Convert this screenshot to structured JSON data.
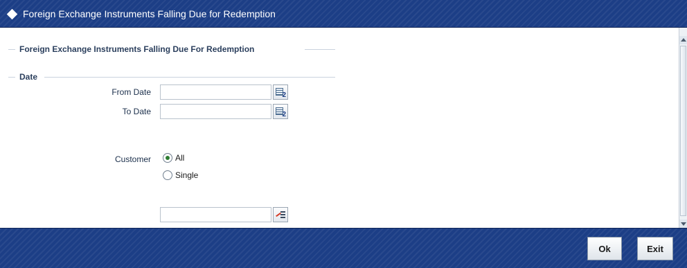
{
  "window": {
    "title": "Foreign Exchange Instruments Falling Due for Redemption"
  },
  "main_section": {
    "legend": "Foreign Exchange Instruments Falling Due For Redemption"
  },
  "date_section": {
    "legend": "Date",
    "from_date_label": "From Date",
    "from_date_value": "",
    "to_date_label": "To Date",
    "to_date_value": ""
  },
  "customer": {
    "label": "Customer",
    "options": [
      {
        "label": "All",
        "selected": true
      },
      {
        "label": "Single",
        "selected": false
      }
    ],
    "single_value": ""
  },
  "footer": {
    "ok_label": "Ok",
    "exit_label": "Exit"
  },
  "icons": {
    "title": "diamond-icon",
    "calendar": "calendar-icon",
    "lov": "list-of-values-icon"
  },
  "colors": {
    "title_bar": "#1c3e86",
    "section_text": "#2b3f5d",
    "radio_selected": "#2e7d32"
  }
}
